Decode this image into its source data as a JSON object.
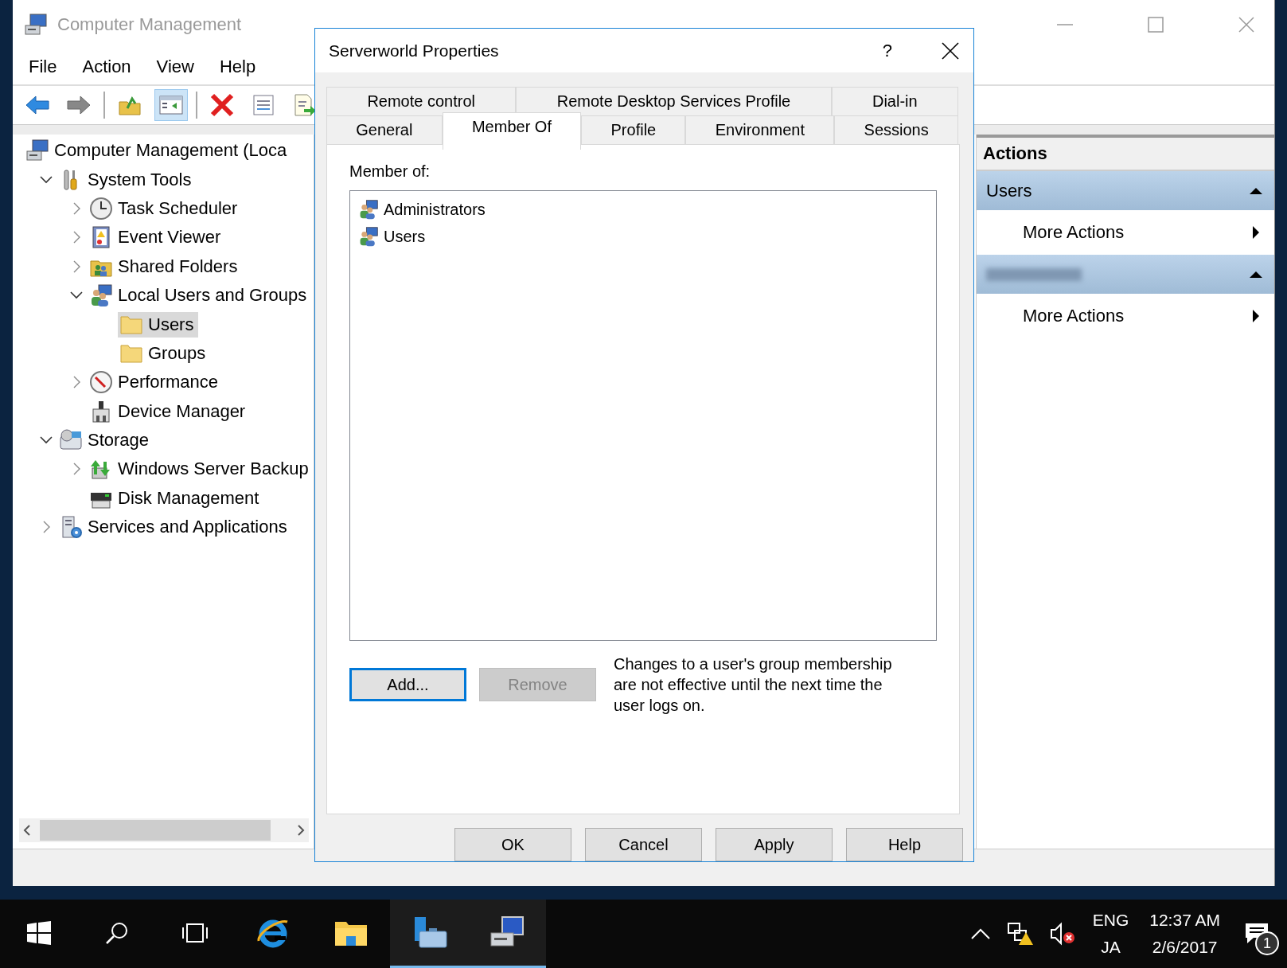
{
  "window": {
    "title": "Computer Management",
    "menu": [
      "File",
      "Action",
      "View",
      "Help"
    ]
  },
  "toolbar": [
    [
      {
        "kind": "back",
        "pressed": false
      },
      {
        "kind": "forward",
        "pressed": false
      }
    ],
    [
      {
        "kind": "up",
        "pressed": false
      },
      {
        "kind": "tree",
        "pressed": true
      }
    ],
    [
      {
        "kind": "delete",
        "pressed": false
      },
      {
        "kind": "properties",
        "pressed": false
      },
      {
        "kind": "export",
        "pressed": false
      }
    ]
  ],
  "tree": [
    {
      "label": "Computer Management (Loca",
      "kind": "computer",
      "selected": false,
      "children": [
        {
          "label": "System Tools",
          "kind": "tools",
          "expanded": true,
          "selected": false,
          "children": [
            {
              "label": "Task Scheduler",
              "kind": "clock",
              "expanded": false,
              "selected": false
            },
            {
              "label": "Event Viewer",
              "kind": "log",
              "expanded": false,
              "selected": false
            },
            {
              "label": "Shared Folders",
              "kind": "shared",
              "expanded": false,
              "selected": false
            },
            {
              "label": "Local Users and Groups",
              "kind": "users",
              "expanded": true,
              "selected": false,
              "children": [
                {
                  "label": "Users",
                  "kind": "folder",
                  "selected": true
                },
                {
                  "label": "Groups",
                  "kind": "folder",
                  "selected": false
                }
              ]
            },
            {
              "label": "Performance",
              "kind": "gauge",
              "expanded": false,
              "selected": false
            },
            {
              "label": "Device Manager",
              "kind": "device",
              "selected": false
            }
          ]
        },
        {
          "label": "Storage",
          "kind": "storage",
          "expanded": true,
          "selected": false,
          "children": [
            {
              "label": "Windows Server Backup",
              "kind": "backup",
              "expanded": false,
              "selected": false
            },
            {
              "label": "Disk Management",
              "kind": "disk",
              "selected": false
            }
          ]
        },
        {
          "label": "Services and Applications",
          "kind": "services",
          "expanded": false,
          "selected": false
        }
      ]
    }
  ],
  "actions": {
    "title": "Actions",
    "sections": [
      {
        "heading": "Users",
        "redacted": false,
        "items": [
          "More Actions"
        ]
      },
      {
        "redacted": true,
        "items": [
          "More Actions"
        ]
      }
    ]
  },
  "dialog": {
    "title": "Serverworld Properties",
    "help": "?",
    "tab_rows": [
      [
        {
          "label": "Remote control",
          "selected": false
        },
        {
          "label": "Remote Desktop Services Profile",
          "selected": false
        },
        {
          "label": "Dial-in",
          "selected": false
        }
      ],
      [
        {
          "label": "General",
          "selected": false
        },
        {
          "label": "Member Of",
          "selected": true
        },
        {
          "label": "Profile",
          "selected": false
        },
        {
          "label": "Environment",
          "selected": false
        },
        {
          "label": "Sessions",
          "selected": false
        }
      ]
    ],
    "member_label": "Member of:",
    "members": [
      "Administrators",
      "Users"
    ],
    "buttons": [
      {
        "label": "Add...",
        "disabled": false,
        "focused": true
      },
      {
        "label": "Remove",
        "disabled": true,
        "focused": false
      }
    ],
    "note": "Changes to a user's group membership are not effective until the next time the user logs on.",
    "footer": [
      "OK",
      "Cancel",
      "Apply",
      "Help"
    ]
  },
  "taskbar": {
    "apps": [
      {
        "kind": "start",
        "running": false
      },
      {
        "kind": "search",
        "running": false
      },
      {
        "kind": "taskview",
        "running": false
      },
      {
        "kind": "browser",
        "running": false
      },
      {
        "kind": "explorer",
        "running": false
      },
      {
        "kind": "servermgr",
        "running": true
      },
      {
        "kind": "compmgmt",
        "running": true
      }
    ],
    "language": [
      "ENG",
      "JA"
    ],
    "time": "12:37 AM",
    "date": "2/6/2017",
    "notifications": "1"
  }
}
